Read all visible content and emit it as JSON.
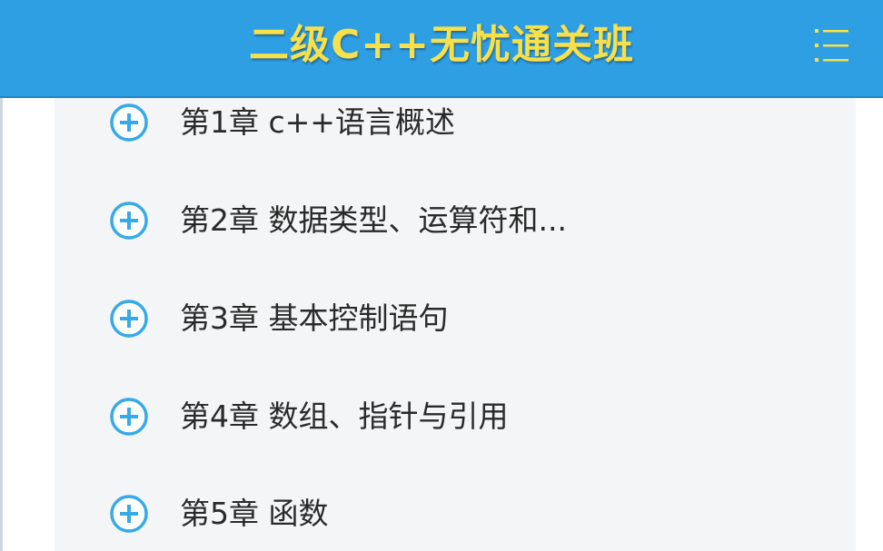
{
  "header": {
    "title": "二级C++无忧通关班",
    "menu_icon": "list-menu-icon"
  },
  "colors": {
    "header_bg": "#2f9fe4",
    "title": "#f7e04a",
    "accent": "#2f9fe4",
    "content_bg": "#f3f5f6"
  },
  "chapters": [
    {
      "label": "第1章 c++语言概述"
    },
    {
      "label": "第2章 数据类型、运算符和..."
    },
    {
      "label": "第3章 基本控制语句"
    },
    {
      "label": "第4章 数组、指针与引用"
    },
    {
      "label": "第5章 函数"
    }
  ]
}
